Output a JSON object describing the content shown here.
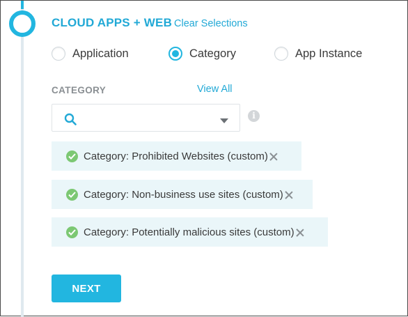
{
  "section": {
    "title": "CLOUD APPS + WEB",
    "clear_label": "Clear Selections"
  },
  "radios": [
    {
      "label": "Application",
      "checked": false
    },
    {
      "label": "Category",
      "checked": true
    },
    {
      "label": "App Instance",
      "checked": false
    }
  ],
  "category": {
    "label": "CATEGORY",
    "view_all": "View All",
    "search_value": "",
    "info_glyph": "i"
  },
  "chips": [
    {
      "label": "Category: Prohibited Websites (custom)"
    },
    {
      "label": "Category: Non-business use sites (custom)"
    },
    {
      "label": "Category: Potentially malicious sites (custom)"
    }
  ],
  "actions": {
    "next_label": "NEXT"
  },
  "colors": {
    "accent": "#22b6e0",
    "link": "#22a9d6",
    "chip_bg": "#eaf6f9",
    "check_green": "#7cc873"
  },
  "icons": {
    "search": "search-icon",
    "dropdown": "chevron-down-icon",
    "info": "info-icon",
    "check": "check-circle-icon",
    "close": "close-icon"
  }
}
